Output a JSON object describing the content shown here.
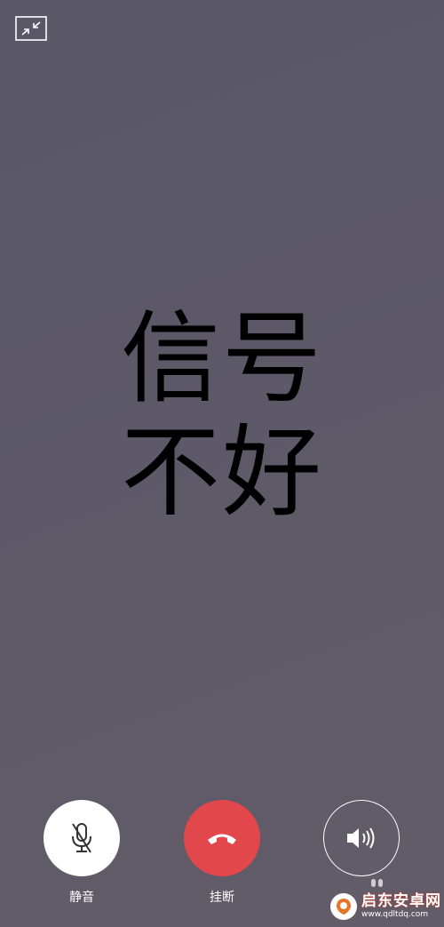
{
  "overlay": {
    "line1": "信号",
    "line2": "不好"
  },
  "controls": {
    "mute_label": "静音",
    "hangup_label": "挂断"
  },
  "watermark": {
    "title": "启东安卓网",
    "url": "www.qdltdq.com"
  },
  "icons": {
    "top_left": "shrink-window-icon",
    "mute": "mic-off-icon",
    "hangup": "hang-up-phone-icon",
    "speaker": "speaker-icon"
  },
  "colors": {
    "background": "#5c5967",
    "hangup": "#e2474b",
    "mute_button": "#ffffff",
    "label": "#ffffff"
  }
}
